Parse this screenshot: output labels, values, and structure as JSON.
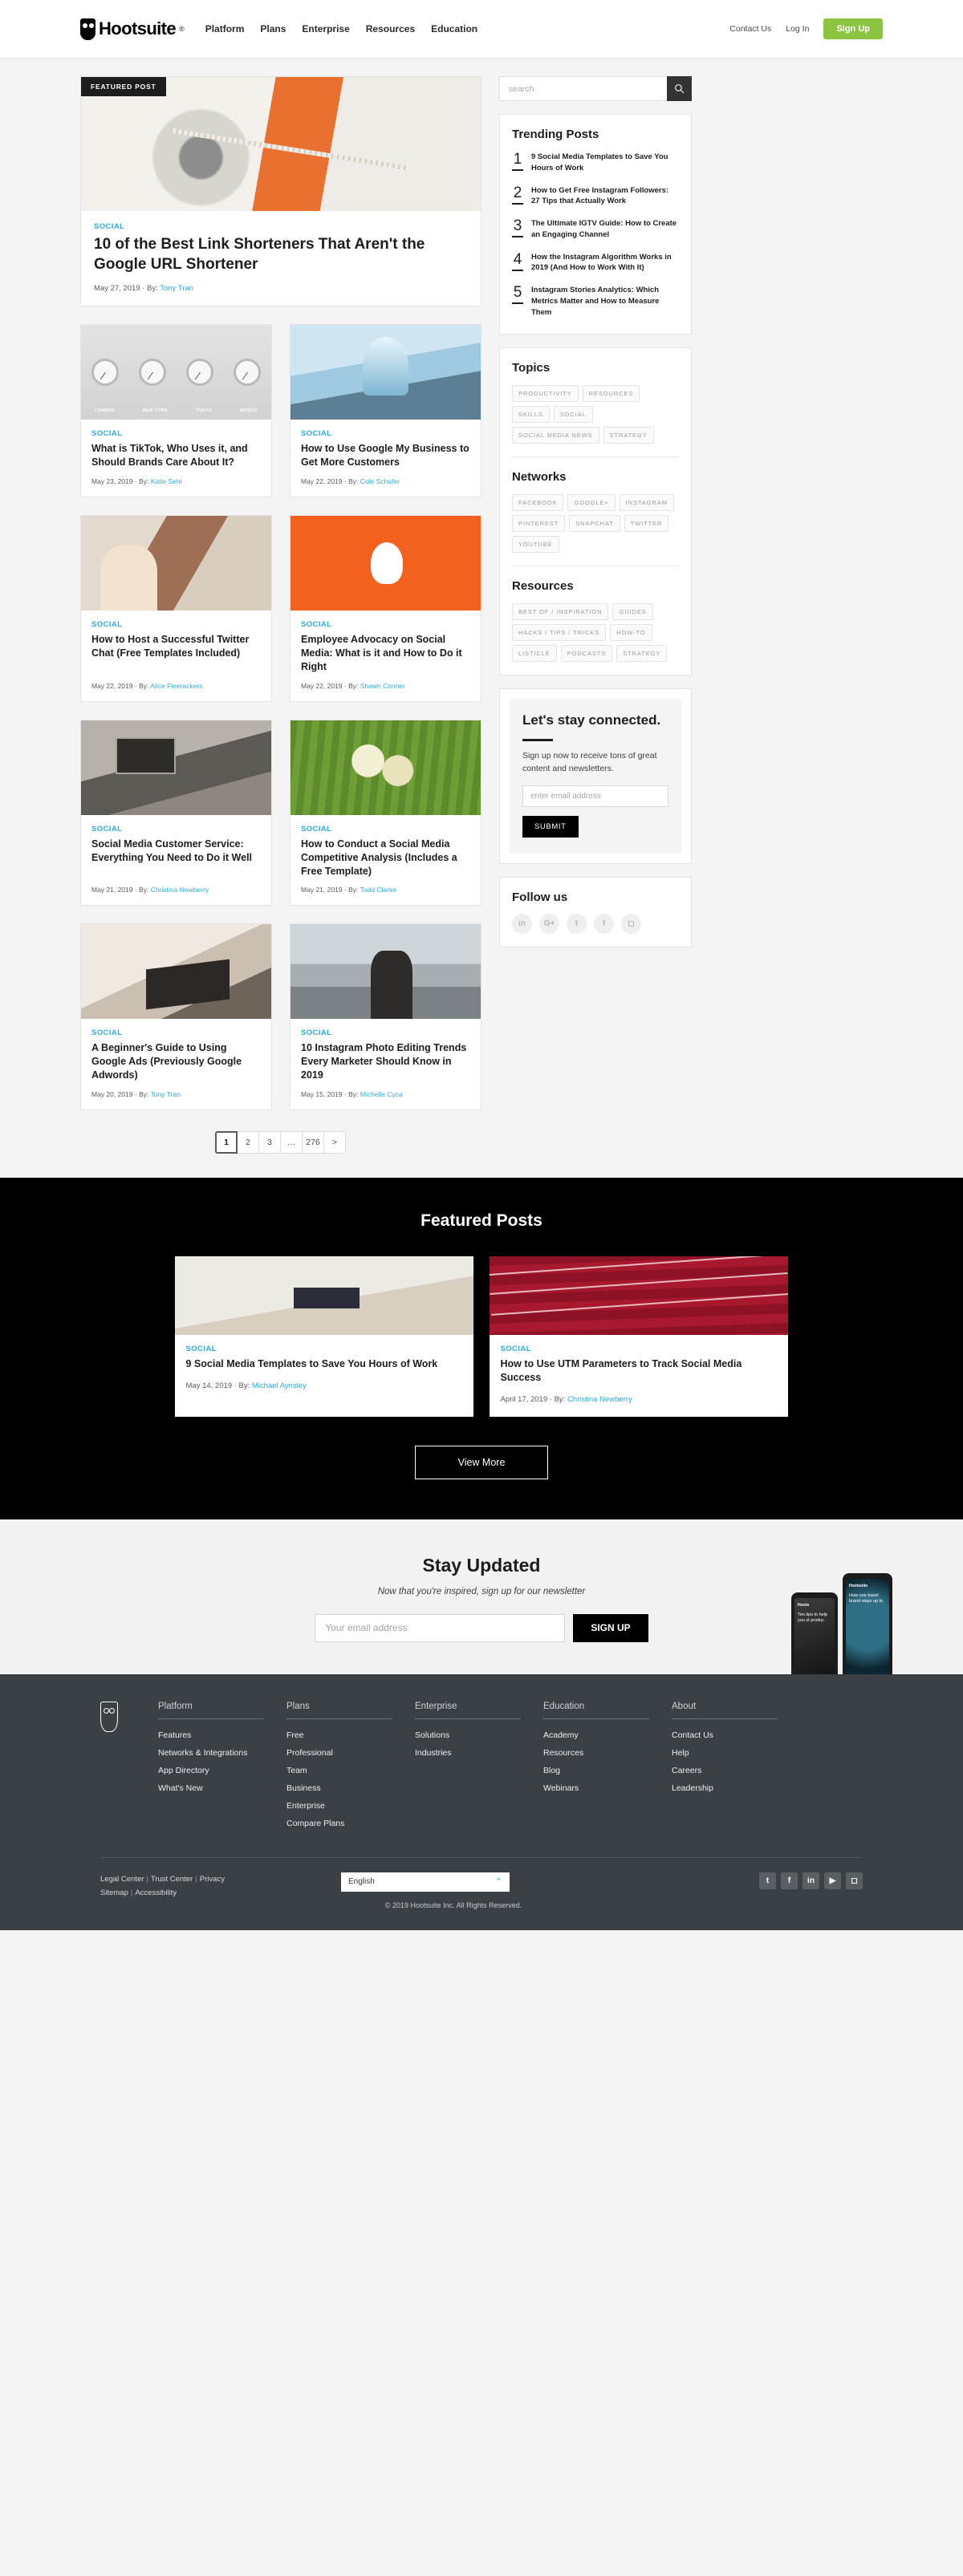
{
  "header": {
    "logo_text": "Hootsuite",
    "logo_reg": "®",
    "nav": [
      {
        "label": "Platform"
      },
      {
        "label": "Plans"
      },
      {
        "label": "Enterprise"
      },
      {
        "label": "Resources"
      },
      {
        "label": "Education"
      }
    ],
    "contact_us": "Contact Us",
    "log_in": "Log In",
    "sign_up": "Sign Up",
    "accent_color": "#8bc53f"
  },
  "featured": {
    "tag": "FEATURED POST",
    "category": "SOCIAL",
    "title": "10 of the Best Link Shorteners That Aren't the Google URL Shortener",
    "date": "May 27, 2019",
    "by_prefix": "· By:",
    "author": "Tony Tran"
  },
  "posts": [
    {
      "category": "SOCIAL",
      "title": "What is TikTok, Who Uses it, and Should Brands Care About It?",
      "date": "May 23, 2019",
      "by_prefix": "· By:",
      "author": "Katie Sehl",
      "art": "img-clocks"
    },
    {
      "category": "SOCIAL",
      "title": "How to Use Google My Business to Get More Customers",
      "date": "May 22, 2019",
      "by_prefix": "· By:",
      "author": "Cole Schafer",
      "art": "img-office"
    },
    {
      "category": "SOCIAL",
      "title": "How to Host a Successful Twitter Chat (Free Templates Included)",
      "date": "May 22, 2019",
      "by_prefix": "· By:",
      "author": "Alice Fleerackers",
      "art": "img-women"
    },
    {
      "category": "SOCIAL",
      "title": "Employee Advocacy on Social Media: What is it and How to Do it Right",
      "date": "May 22, 2019",
      "by_prefix": "· By:",
      "author": "Shawn Conner",
      "art": "img-orange"
    },
    {
      "category": "SOCIAL",
      "title": "Social Media Customer Service: Everything You Need to Do it Well",
      "date": "May 21, 2019",
      "by_prefix": "· By:",
      "author": "Christina Newberry",
      "art": "img-desk"
    },
    {
      "category": "SOCIAL",
      "title": "How to Conduct a Social Media Competitive Analysis (Includes a Free Template)",
      "date": "May 21, 2019",
      "by_prefix": "· By:",
      "author": "Todd Clarke",
      "art": "img-field"
    },
    {
      "category": "SOCIAL",
      "title": "A Beginner's Guide to Using Google Ads (Previously Google Adwords)",
      "date": "May 20, 2019",
      "by_prefix": "· By:",
      "author": "Tony Tran",
      "art": "img-laptop"
    },
    {
      "category": "SOCIAL",
      "title": "10 Instagram Photo Editing Trends Every Marketer Should Know in 2019",
      "date": "May 15, 2019",
      "by_prefix": "· By:",
      "author": "Michelle Cyca",
      "art": "img-street"
    }
  ],
  "pagination": {
    "items": [
      "1",
      "2",
      "3",
      "…",
      "276",
      ">"
    ],
    "active_index": 0
  },
  "sidebar": {
    "search": {
      "placeholder": "search",
      "icon": "search-icon"
    },
    "trending": {
      "title": "Trending Posts",
      "items": [
        {
          "num": "1",
          "text": "9 Social Media Templates to Save You Hours of Work"
        },
        {
          "num": "2",
          "text": "How to Get Free Instagram Followers: 27 Tips that Actually Work"
        },
        {
          "num": "3",
          "text": "The Ultimate IGTV Guide: How to Create an Engaging Channel"
        },
        {
          "num": "4",
          "text": "How the Instagram Algorithm Works in 2019 (And How to Work With It)"
        },
        {
          "num": "5",
          "text": "Instagram Stories Analytics: Which Metrics Matter and How to Measure Them"
        }
      ]
    },
    "topics": {
      "title": "Topics",
      "tags": [
        "PRODUCTIVITY",
        "RESOURCES",
        "SKILLS",
        "SOCIAL",
        "SOCIAL MEDIA NEWS",
        "STRATEGY"
      ]
    },
    "networks": {
      "title": "Networks",
      "tags": [
        "FACEBOOK",
        "GOOGLE+",
        "INSTAGRAM",
        "PINTEREST",
        "SNAPCHAT",
        "TWITTER",
        "YOUTUBE"
      ]
    },
    "resources": {
      "title": "Resources",
      "tags": [
        "BEST OF / INSPIRATION",
        "GUIDES",
        "HACKS / TIPS / TRICKS",
        "HOW-TO",
        "LISTICLE",
        "PODCASTS",
        "STRATEGY"
      ]
    },
    "stay_connected": {
      "title": "Let's stay connected.",
      "copy": "Sign up now to receive tons of great content and newsletters.",
      "email_placeholder": "enter email address",
      "submit_label": "SUBMIT"
    },
    "follow": {
      "title": "Follow us",
      "icons": [
        {
          "name": "linkedin-icon",
          "glyph": "in"
        },
        {
          "name": "google-plus-icon",
          "glyph": "G+"
        },
        {
          "name": "twitter-icon",
          "glyph": "t"
        },
        {
          "name": "facebook-icon",
          "glyph": "f"
        },
        {
          "name": "instagram-icon",
          "glyph": "◻"
        }
      ]
    }
  },
  "featured_band": {
    "title": "Featured Posts",
    "cards": [
      {
        "category": "SOCIAL",
        "title": "9 Social Media Templates to Save You Hours of Work",
        "date": "May 14, 2019",
        "by_prefix": "· By:",
        "author": "Michael Aynsley",
        "art": "img-tpl"
      },
      {
        "category": "SOCIAL",
        "title": "How to Use UTM Parameters to Track Social Media Success",
        "date": "April 17, 2019",
        "by_prefix": "· By:",
        "author": "Christina Newberry",
        "art": "img-red"
      }
    ],
    "view_more": "View More"
  },
  "stay_updated": {
    "title": "Stay Updated",
    "subtitle": "Now that you're inspired, sign up for our newsletter",
    "email_placeholder": "Your email address",
    "button_label": "SIGN UP",
    "phone_left_brand": "Hoots",
    "phone_left_copy": "Ten tips to help you st produc",
    "phone_right_brand": "Hootsuite",
    "phone_right_copy": "How one travel brand stays up to"
  },
  "footer": {
    "columns": [
      {
        "heading": "Platform",
        "links": [
          "Features",
          "Networks & Integrations",
          "App Directory",
          "What's New"
        ]
      },
      {
        "heading": "Plans",
        "links": [
          "Free",
          "Professional",
          "Team",
          "Business",
          "Enterprise",
          "Compare Plans"
        ]
      },
      {
        "heading": "Enterprise",
        "links": [
          "Solutions",
          "Industries"
        ]
      },
      {
        "heading": "Education",
        "links": [
          "Academy",
          "Resources",
          "Blog",
          "Webinars"
        ]
      },
      {
        "heading": "About",
        "links": [
          "Contact Us",
          "Help",
          "Careers",
          "Leadership"
        ]
      }
    ],
    "legal_line1": [
      "Legal Center",
      "Trust Center",
      "Privacy"
    ],
    "legal_line2": [
      "Sitemap",
      "Accessibility"
    ],
    "language": "English",
    "language_caret": "⌃",
    "copyright": "© 2019 Hootsuite Inc. All Rights Reserved.",
    "social": [
      {
        "name": "twitter-icon",
        "glyph": "t"
      },
      {
        "name": "facebook-icon",
        "glyph": "f"
      },
      {
        "name": "linkedin-icon",
        "glyph": "in"
      },
      {
        "name": "youtube-icon",
        "glyph": "▶"
      },
      {
        "name": "instagram-icon",
        "glyph": "◻"
      }
    ]
  }
}
